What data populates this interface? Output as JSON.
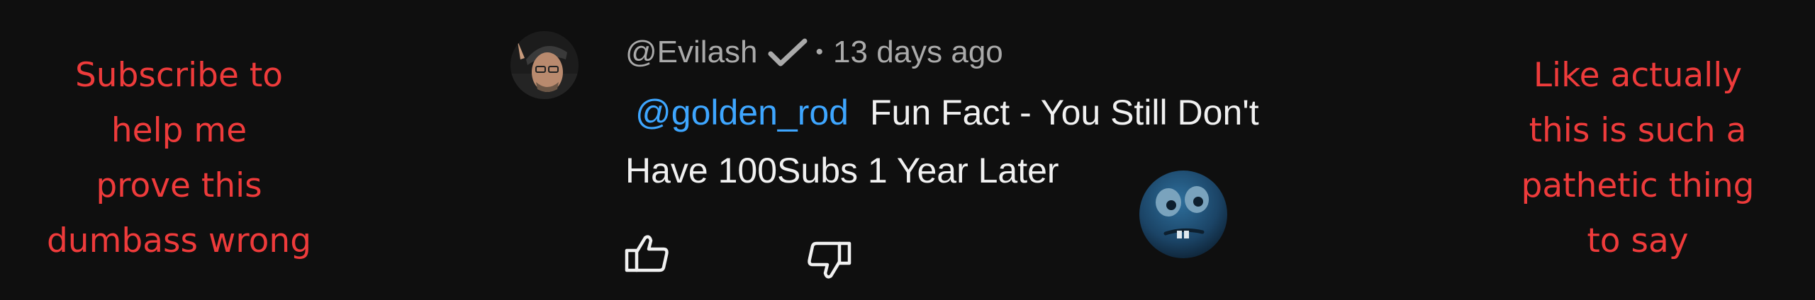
{
  "left_caption": {
    "lines": [
      "Subscribe to",
      "help me",
      "prove this",
      "dumbass wrong"
    ]
  },
  "right_caption": {
    "lines": [
      "Like actually",
      "this is such a",
      "pathetic thing",
      "to say"
    ]
  },
  "comment": {
    "author": "@Evilash",
    "verified_icon": "checkmark-icon",
    "separator": "•",
    "time": "13 days ago",
    "mention": "@golden_rod",
    "text_line1": "Fun Fact - You Still Don't",
    "text_line2": "Have 100Subs 1 Year Later",
    "actions": {
      "like_icon": "thumbs-up-icon",
      "dislike_icon": "thumbs-down-icon"
    }
  },
  "colors": {
    "background": "#0f0f0f",
    "caption_red": "#ee3b3b",
    "mention_blue": "#3ea6ff",
    "meta_gray": "#aaaaaa",
    "text_white": "#f1f1f1"
  }
}
